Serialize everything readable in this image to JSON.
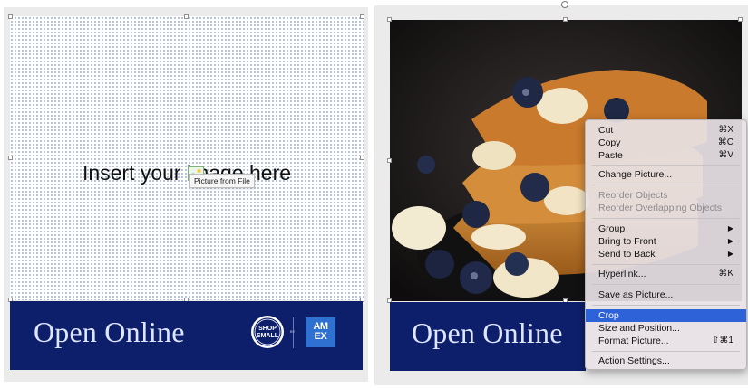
{
  "left": {
    "placeholder_text": "Insert your image here",
    "tooltip": "Picture from File",
    "banner_text": "Open Online",
    "shop_small_line1": "SHOP",
    "shop_small_line2": "SMALL",
    "by": "BY",
    "amex_line1": "AM",
    "amex_line2": "EX"
  },
  "right": {
    "banner_text": "Open Online"
  },
  "context_menu": {
    "items": [
      {
        "label": "Cut",
        "shortcut": "⌘X",
        "enabled": true
      },
      {
        "label": "Copy",
        "shortcut": "⌘C",
        "enabled": true
      },
      {
        "label": "Paste",
        "shortcut": "⌘V",
        "enabled": true
      },
      {
        "label": "Change Picture...",
        "shortcut": "",
        "enabled": true
      },
      {
        "label": "Reorder Objects",
        "shortcut": "",
        "enabled": false
      },
      {
        "label": "Reorder Overlapping Objects",
        "shortcut": "",
        "enabled": false
      },
      {
        "label": "Group",
        "shortcut": "",
        "enabled": true,
        "submenu": true
      },
      {
        "label": "Bring to Front",
        "shortcut": "",
        "enabled": true,
        "submenu": true
      },
      {
        "label": "Send to Back",
        "shortcut": "",
        "enabled": true,
        "submenu": true
      },
      {
        "label": "Hyperlink...",
        "shortcut": "⌘K",
        "enabled": true
      },
      {
        "label": "Save as Picture...",
        "shortcut": "",
        "enabled": true
      },
      {
        "label": "Crop",
        "shortcut": "",
        "enabled": true,
        "highlighted": true
      },
      {
        "label": "Size and Position...",
        "shortcut": "",
        "enabled": true
      },
      {
        "label": "Format Picture...",
        "shortcut": "⇧⌘1",
        "enabled": true
      },
      {
        "label": "Action Settings...",
        "shortcut": "",
        "enabled": true
      }
    ]
  },
  "colors": {
    "banner": "#0d1f6b",
    "menu_highlight": "#2e62d9",
    "amex_blue": "#2f71d1"
  }
}
